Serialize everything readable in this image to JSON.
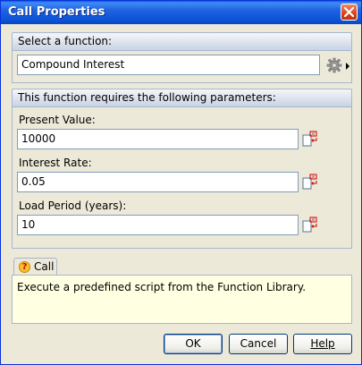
{
  "window": {
    "title": "Call Properties"
  },
  "icons": {
    "close": "close-icon",
    "settings": "gear-icon",
    "expand": "chevron-right-icon",
    "param": "script-parameter-icon",
    "help": "question-icon"
  },
  "function_section": {
    "header": "Select a function:",
    "selected_function": "Compound Interest"
  },
  "params_section": {
    "header": "This function requires the following parameters:",
    "params": [
      {
        "label": "Present Value:",
        "value": "10000"
      },
      {
        "label": "Interest Rate:",
        "value": "0.05"
      },
      {
        "label": "Load Period (years):",
        "value": "10"
      }
    ]
  },
  "description": {
    "tab_label": "Call",
    "text": "Execute a predefined script from the Function Library."
  },
  "buttons": {
    "ok": "OK",
    "cancel": "Cancel",
    "help": "Help"
  },
  "colors": {
    "titlebar": "#0a52d6",
    "dialog_bg": "#ece9d8",
    "description_bg": "#ffffe1",
    "icon_red": "#cc0000"
  }
}
